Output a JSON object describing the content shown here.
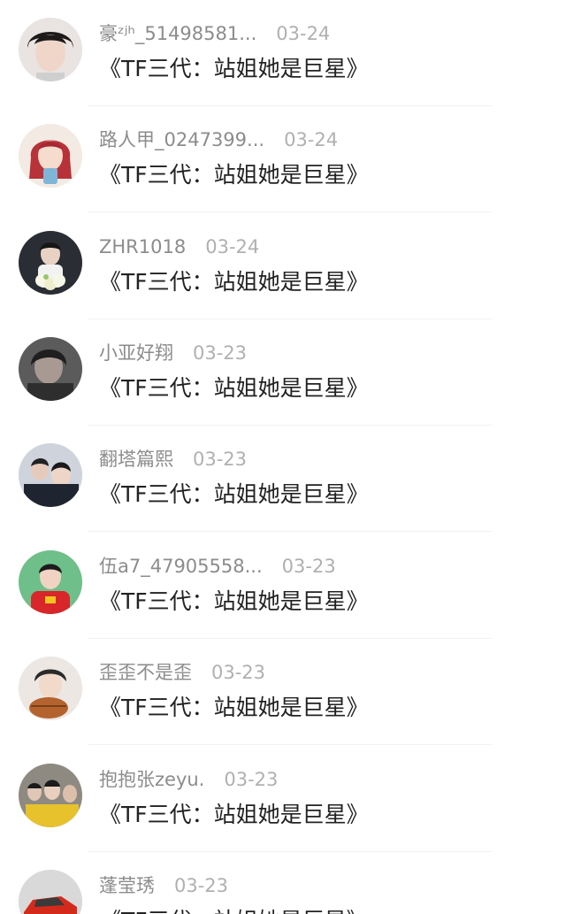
{
  "comments": [
    {
      "username": "豪ᶻʲʰ_51498581...",
      "date": "03-24",
      "text": "《TF三代：站姐她是巨星》",
      "avatar": "avatar-young-man-dark-hair"
    },
    {
      "username": "路人甲_0247399...",
      "date": "03-24",
      "text": "《TF三代：站姐她是巨星》",
      "avatar": "avatar-red-hair-girl"
    },
    {
      "username": "ZHR1018",
      "date": "03-24",
      "text": "《TF三代：站姐她是巨星》",
      "avatar": "avatar-singer-with-flowers"
    },
    {
      "username": "小亚好翔",
      "date": "03-23",
      "text": "《TF三代：站姐她是巨星》",
      "avatar": "avatar-dark-portrait"
    },
    {
      "username": "翻塔篇熙",
      "date": "03-23",
      "text": "《TF三代：站姐她是巨星》",
      "avatar": "avatar-two-boys"
    },
    {
      "username": "伍a7_47905558...",
      "date": "03-23",
      "text": "《TF三代：站姐她是巨星》",
      "avatar": "avatar-boy-red-shirt-green-bg"
    },
    {
      "username": "歪歪不是歪",
      "date": "03-23",
      "text": "《TF三代：站姐她是巨星》",
      "avatar": "avatar-boy-with-hat"
    },
    {
      "username": "抱抱张zeyu.",
      "date": "03-23",
      "text": "《TF三代：站姐她是巨星》",
      "avatar": "avatar-group-yellow"
    },
    {
      "username": "蓬莹琇",
      "date": "03-23",
      "text": "《TF三代：站姐她是巨星》",
      "avatar": "avatar-red-car"
    }
  ],
  "colors": {
    "username": "#8c8c8c",
    "date": "#b0b0b0",
    "text": "#222222",
    "divider": "#f1f1f1"
  }
}
